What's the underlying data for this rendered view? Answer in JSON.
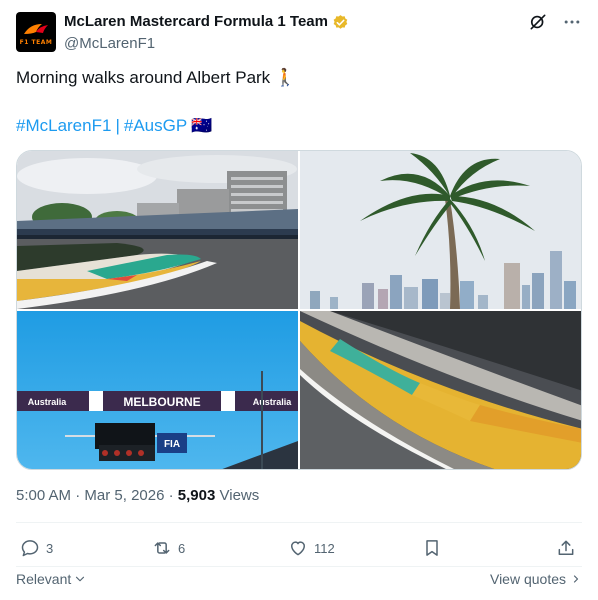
{
  "author": {
    "display_name": "McLaren Mastercard Formula 1 Team",
    "handle": "@McLarenF1",
    "verified_badge_color": "#e8b829",
    "avatar_logo_text": "F1 TEAM",
    "avatar_icon": "mclaren-logo-icon"
  },
  "header_actions": {
    "grok_icon": "grok-icon",
    "more_icon": "more-horizontal-icon"
  },
  "tweet": {
    "text": "Morning walks around Albert Park 🚶",
    "hashtags": [
      "#McLarenF1",
      "#AusGP"
    ],
    "separator": "|",
    "flag": "🇦🇺"
  },
  "media": {
    "images": [
      {
        "name": "track-grandstand-photo"
      },
      {
        "name": "palm-tree-skyline-photo"
      },
      {
        "name": "melbourne-start-gantry-photo",
        "banner_left": "Australia",
        "banner_center": "MELBOURNE",
        "banner_right": "Australia",
        "badge": "FIA"
      },
      {
        "name": "kerb-closeup-photo"
      }
    ]
  },
  "meta": {
    "time": "5:00 AM",
    "dot1": "·",
    "date": "Mar 5, 2026",
    "dot2": "·",
    "views_count": "5,903",
    "views_label": "Views"
  },
  "actions": {
    "replies": "3",
    "reposts": "6",
    "likes": "112"
  },
  "footer": {
    "sort_label": "Relevant",
    "view_quotes_label": "View quotes"
  },
  "colors": {
    "accent": "#1d9bf0",
    "muted": "#536471",
    "mclaren_orange": "#ff8000"
  }
}
